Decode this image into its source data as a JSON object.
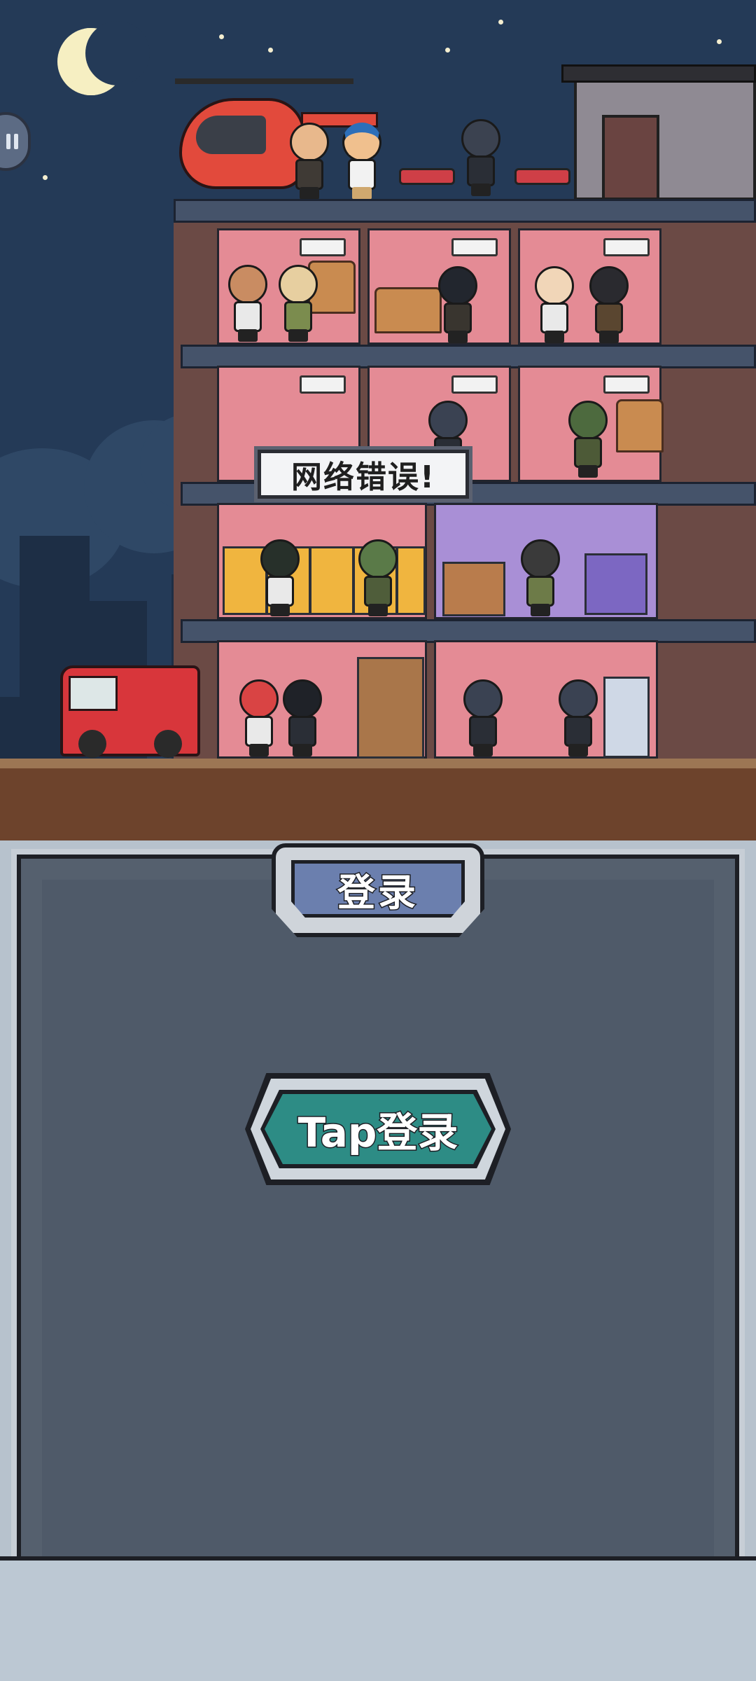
{
  "game": {
    "error_message": "网络错误!",
    "login_tab_label": "登录",
    "tap_login_label": "Tap登录"
  },
  "colors": {
    "sky": "#243a57",
    "panel": "#4f5a69",
    "tap_button": "#2d8c85",
    "tab": "#6b7fae"
  }
}
